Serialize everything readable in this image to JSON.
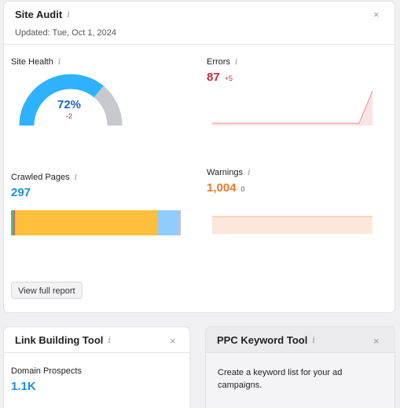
{
  "site_audit": {
    "title": "Site Audit",
    "info_icon": "i",
    "close_icon": "×",
    "updated": "Updated: Tue, Oct 1, 2024",
    "site_health": {
      "label": "Site Health",
      "value": "72%",
      "delta": "-2",
      "fraction": 0.72,
      "color": "#2eb2ff",
      "rest_color": "#c8c9cf"
    },
    "errors": {
      "label": "Errors",
      "value": "87",
      "delta": "+5",
      "color": "#d0283a",
      "trend": [
        0,
        0,
        0,
        0,
        0,
        0,
        0,
        0,
        0,
        0,
        0,
        0,
        1
      ]
    },
    "crawled": {
      "label": "Crawled Pages",
      "value": "297",
      "segments": [
        {
          "fraction": 0.015,
          "color": "#4dbf82"
        },
        {
          "fraction": 0.01,
          "color": "#e35b58"
        },
        {
          "fraction": 0.83,
          "color": "#ffbe3c"
        },
        {
          "fraction": 0.12,
          "color": "#8fccff"
        },
        {
          "fraction": 0.015,
          "color": "#c0c2c8"
        }
      ]
    },
    "warnings": {
      "label": "Warnings",
      "value": "1,004",
      "delta": "0",
      "color": "#f0782a"
    },
    "view_report": "View full report"
  },
  "link_building": {
    "title": "Link Building Tool",
    "info_icon": "i",
    "close_icon": "×",
    "metric_label": "Domain Prospects",
    "metric_value": "1.1K"
  },
  "ppc": {
    "title": "PPC Keyword Tool",
    "info_icon": "i",
    "close_icon": "×",
    "description": "Create a keyword list for your ad campaigns."
  }
}
